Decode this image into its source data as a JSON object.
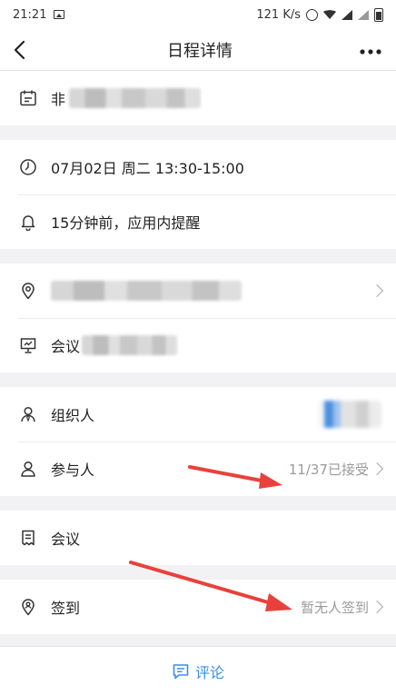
{
  "status_bar": {
    "time": "21:21",
    "speed": "121 K/s"
  },
  "nav": {
    "title": "日程详情"
  },
  "schedule": {
    "title_prefix": "非"
  },
  "time_section": {
    "datetime": "07月02日 周二 13:30-15:00",
    "reminder": "15分钟前，应用内提醒"
  },
  "location_section": {
    "room_prefix": "会议"
  },
  "people_section": {
    "organizer_label": "组织人",
    "participants_label": "参与人",
    "participants_status": "11/37已接受"
  },
  "meeting_section": {
    "label": "会议"
  },
  "checkin_section": {
    "label": "签到",
    "status": "暂无人签到"
  },
  "bottom": {
    "comment_label": "评论"
  },
  "colors": {
    "accent": "#3a8ee6",
    "annotation_arrow": "#e8413c"
  }
}
